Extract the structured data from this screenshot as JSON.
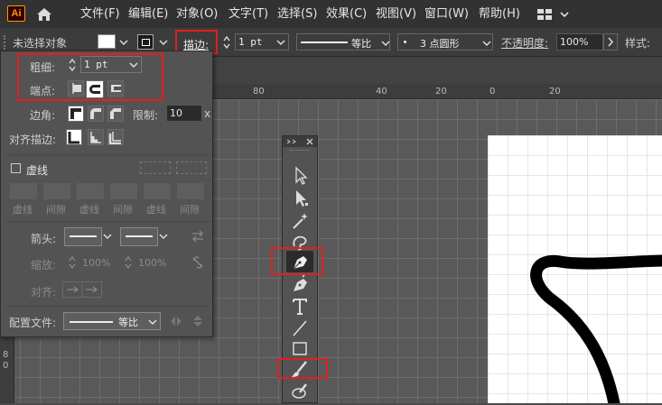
{
  "app": {
    "logo_text": "Ai"
  },
  "menubar": {
    "items": [
      "文件(F)",
      "编辑(E)",
      "对象(O)",
      "文字(T)",
      "选择(S)",
      "效果(C)",
      "视图(V)",
      "窗口(W)",
      "帮助(H)"
    ]
  },
  "control_bar": {
    "selection_label": "未选择对象",
    "stroke_label": "描边:",
    "stroke_weight": "1 pt",
    "profile_label": "等比",
    "brush_label": "3 点圆形",
    "opacity_label": "不透明度:",
    "opacity_value": "100%",
    "style_label": "样式:"
  },
  "stroke_panel": {
    "weight_label": "粗细:",
    "weight_value": "1 pt",
    "cap_label": "端点:",
    "corner_label": "边角:",
    "limit_label": "限制:",
    "limit_value": "10",
    "limit_unit": "x",
    "align_label": "对齐描边:",
    "dashed_label": "虚线",
    "dash_labels": [
      "虚线",
      "间隙",
      "虚线",
      "间隙",
      "虚线",
      "间隙"
    ],
    "arrow_label": "箭头:",
    "scale_label": "缩放:",
    "scale_value_1": "100%",
    "scale_value_2": "100%",
    "align_arrow_label": "对齐:",
    "profile_label": "配置文件:",
    "profile_value": "等比"
  },
  "ruler": {
    "top_ticks": [
      "80",
      "40",
      "20",
      "0",
      "20"
    ],
    "left_ticks": [
      "8",
      "0"
    ]
  },
  "colors": {
    "highlight": "#e02020",
    "menubar_bg": "#323232",
    "panel_bg": "#535353",
    "canvas_bg": "#595959"
  }
}
